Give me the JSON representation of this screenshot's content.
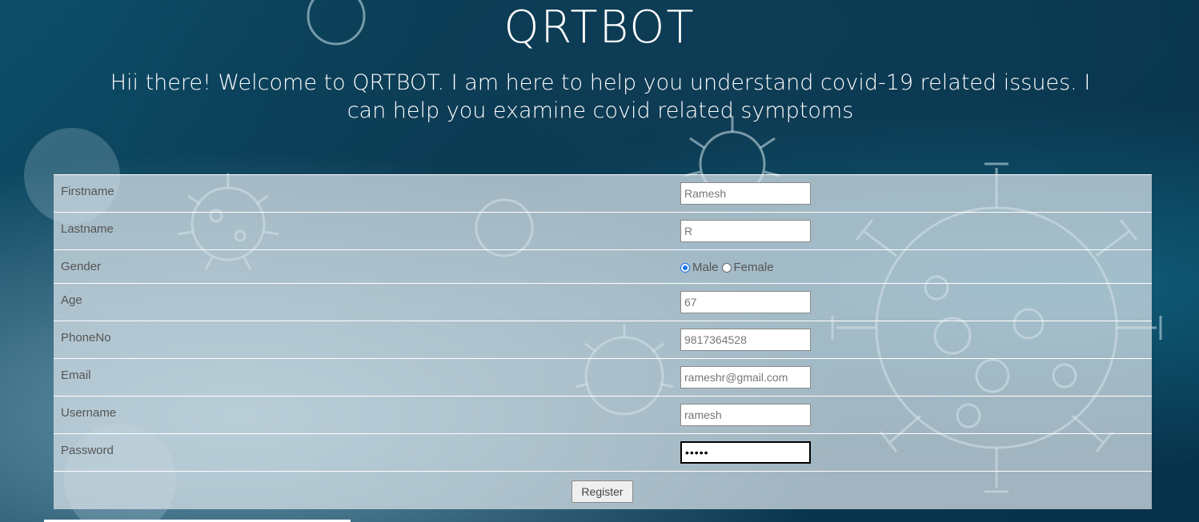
{
  "header": {
    "title": "QRTBOT",
    "welcome": "Hii there! Welcome to QRTBOT. I am here to help you understand covid-19 related issues. I can help you examine covid related symptoms"
  },
  "form": {
    "firstname": {
      "label": "Firstname",
      "value": "Ramesh"
    },
    "lastname": {
      "label": "Lastname",
      "value": "R"
    },
    "gender": {
      "label": "Gender",
      "options": [
        "Male",
        "Female"
      ],
      "selected": "Male"
    },
    "age": {
      "label": "Age",
      "value": "67"
    },
    "phone": {
      "label": "PhoneNo",
      "value": "9817364528"
    },
    "email": {
      "label": "Email",
      "value": "rameshr@gmail.com"
    },
    "username": {
      "label": "Username",
      "value": "ramesh"
    },
    "password": {
      "label": "Password",
      "value": "•••••"
    },
    "register_label": "Register"
  },
  "colors": {
    "background": "#0a3a52",
    "form_panel": "#d7e1e8",
    "radio_accent": "#1a73e8"
  }
}
